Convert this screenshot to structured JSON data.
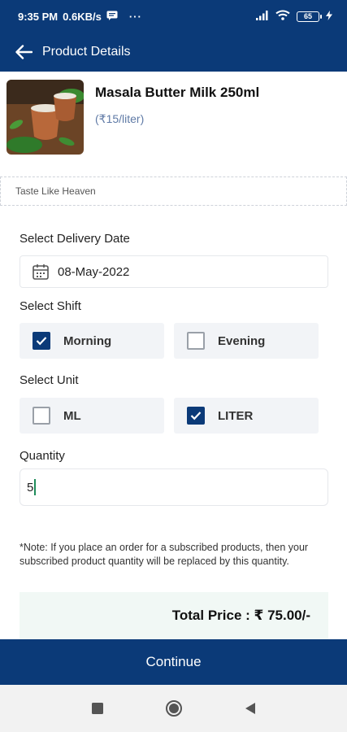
{
  "status": {
    "time": "9:35 PM",
    "speed": "0.6KB/s",
    "more": "···",
    "battery": "65"
  },
  "header": {
    "title": "Product Details"
  },
  "product": {
    "name": "Masala Butter Milk 250ml",
    "price": "(₹15/liter)",
    "tagline": "Taste Like Heaven"
  },
  "form": {
    "date_label": "Select Delivery Date",
    "date_value": "08-May-2022",
    "shift_label": "Select Shift",
    "shift_options": [
      {
        "label": "Morning",
        "checked": true
      },
      {
        "label": "Evening",
        "checked": false
      }
    ],
    "unit_label": "Select Unit",
    "unit_options": [
      {
        "label": "ML",
        "checked": false
      },
      {
        "label": "LITER",
        "checked": true
      }
    ],
    "quantity_label": "Quantity",
    "quantity_value": "5"
  },
  "note": "*Note: If you place an order for a subscribed products, then your subscribed product quantity will be replaced by this quantity.",
  "total": "Total Price : ₹ 75.00/-",
  "actions": {
    "continue": "Continue"
  },
  "colors": {
    "primary": "#0b3a78",
    "price": "#5f7aa6",
    "total_bg": "#f1f8f5"
  }
}
